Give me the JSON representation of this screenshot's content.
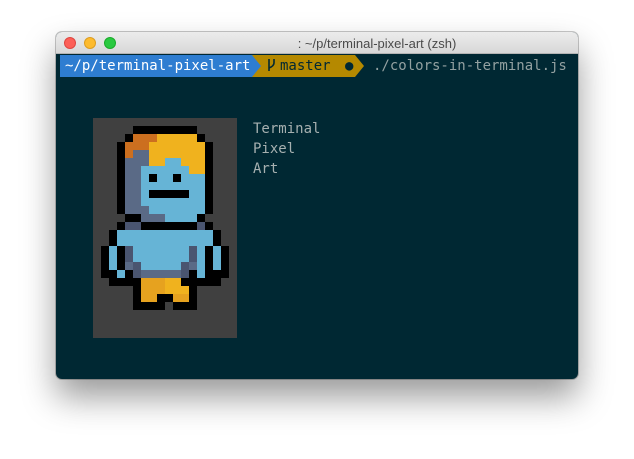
{
  "window": {
    "title": ": ~/p/terminal-pixel-art (zsh)"
  },
  "prompt": {
    "path": "~/p/terminal-pixel-art",
    "branch_icon": "git-branch-icon",
    "branch": "master",
    "status": "●",
    "command": "./colors-in-terminal.js"
  },
  "output_lines": [
    "Terminal",
    "Pixel",
    "Art"
  ],
  "colors": {
    "terminal_bg": "#002833",
    "path_segment": "#2e7dd1",
    "git_segment": "#b58900",
    "art_bg": "#404040"
  },
  "pixel_art": {
    "palette": {
      ".": "transparent",
      "K": "#000000",
      "O": "#cc6f1f",
      "Y": "#f0b21e",
      "D": "#5a6a86",
      "L": "#66b4d6",
      "G": "#4a5570",
      "A": "#e6a21f"
    },
    "rows": [
      "....KKKKKKKK....",
      "...KOOOYYYYYK...",
      "..KOOOYYYYYYYK..",
      "..KODDYYYYYYYK..",
      "..KDDDYYLLYYYK..",
      "..KDDLLLLLLYYK..",
      "..KDDLKLLKLLLK..",
      "..KDDLLLLLLLLK..",
      "..KDDLKKKKKLLK..",
      "..KDDLLLLLLLLK..",
      "..KDDDLLLLLLLK..",
      "...KKDDDLLLLK...",
      "..KGGKKKKKKKGK..",
      ".KLLLLLLLLLLLLK.",
      ".KLLLLLLLLLLLLK.",
      "KLKGLLLLLLLGLKLK",
      "KLKGLLLLLLLGLKLK",
      "KLKDGLLLLLGDLKLK",
      "KKLKGDDDDDGKLKKK",
      ".KKKKAAAYYKKKKK.",
      "....KAAAYYYK....",
      "....KAAKKAAK....",
      "....KKKK.KKK...."
    ]
  }
}
